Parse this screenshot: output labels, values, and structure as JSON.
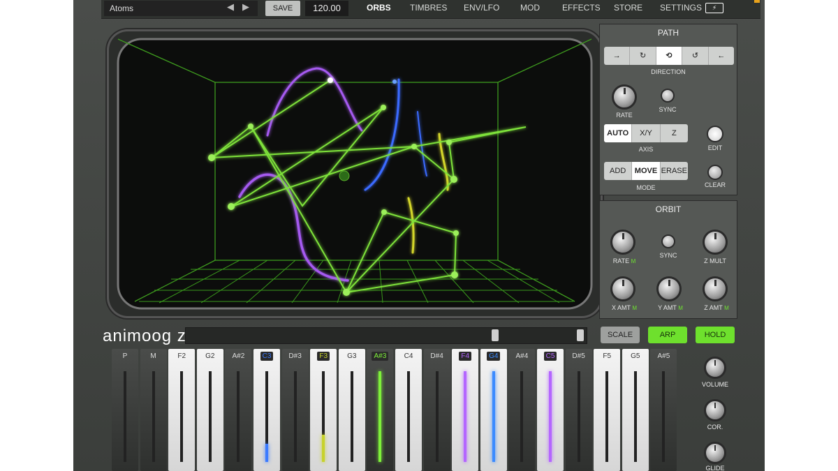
{
  "preset": {
    "name": "Atoms",
    "prev_icon": "◀",
    "next_icon": "▶"
  },
  "save_label": "SAVE",
  "tempo": "120.00",
  "nav": [
    "ORBS",
    "TIMBRES",
    "ENV/LFO",
    "MOD",
    "EFFECTS",
    "STORE",
    "SETTINGS"
  ],
  "nav_active": "ORBS",
  "battery_icon": "⚡",
  "path": {
    "title": "PATH",
    "direction_label": "DIRECTION",
    "direction_icons": [
      "→",
      "↻",
      "⟲",
      "↺",
      "←"
    ],
    "rate_label": "RATE",
    "sync_label": "SYNC",
    "axis_options": [
      "AUTO",
      "X/Y",
      "Z"
    ],
    "axis_label": "AXIS",
    "edit_label": "EDIT",
    "mode_options": [
      "ADD",
      "MOVE",
      "ERASE"
    ],
    "mode_label": "MODE",
    "clear_label": "CLEAR"
  },
  "orbit": {
    "title": "ORBIT",
    "rate_label": "RATE",
    "sync_label": "SYNC",
    "zmult_label": "Z MULT",
    "xamt_label": "X AMT",
    "yamt_label": "Y AMT",
    "zamt_label": "Z AMT",
    "mod_tag": "M"
  },
  "logo": "animoog z",
  "keyboard_buttons": {
    "scale": "SCALE",
    "arp": "ARP",
    "hold": "HOLD"
  },
  "keys": [
    {
      "label": "P",
      "type": "b"
    },
    {
      "label": "M",
      "type": "b"
    },
    {
      "label": "F2",
      "type": "w"
    },
    {
      "label": "G2",
      "type": "w"
    },
    {
      "label": "A#2",
      "type": "b"
    },
    {
      "label": "C3",
      "type": "w",
      "color": "#3b7bff",
      "fill": 0.2
    },
    {
      "label": "D#3",
      "type": "b"
    },
    {
      "label": "F3",
      "type": "w",
      "color": "#c7d22b",
      "fill": 0.3
    },
    {
      "label": "G3",
      "type": "w"
    },
    {
      "label": "A#3",
      "type": "b",
      "color": "#7ef03a",
      "fill": 1.0
    },
    {
      "label": "C4",
      "type": "w"
    },
    {
      "label": "D#4",
      "type": "b"
    },
    {
      "label": "F4",
      "type": "w",
      "color": "#b466ff",
      "fill": 1.0
    },
    {
      "label": "G4",
      "type": "w",
      "color": "#3b8bff",
      "fill": 1.0
    },
    {
      "label": "A#4",
      "type": "b"
    },
    {
      "label": "C5",
      "type": "w",
      "color": "#b466ff",
      "fill": 1.0
    },
    {
      "label": "D#5",
      "type": "b"
    },
    {
      "label": "F5",
      "type": "w"
    },
    {
      "label": "G5",
      "type": "w"
    },
    {
      "label": "A#5",
      "type": "b"
    }
  ],
  "side_controls": {
    "volume": "VOLUME",
    "cor": "COR.",
    "glide": "GLIDE"
  },
  "colors": {
    "accent_green": "#6ee02d",
    "path_green": "#7ee23a",
    "orb_purple": "#a55af0",
    "orb_blue": "#3a6bff",
    "orb_yellow": "#d4d62c"
  }
}
